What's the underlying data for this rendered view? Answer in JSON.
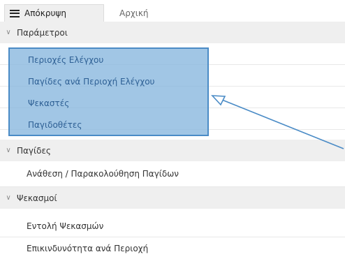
{
  "tabs": [
    {
      "label": "Απόκρυψη",
      "icon": "hamburger-icon",
      "active": true
    },
    {
      "label": "Αρχική",
      "active": false
    }
  ],
  "sections": [
    {
      "label": "Παράμετροι",
      "icon": "chevron-down-icon",
      "items": [
        "Περιοχές Ελέγχου",
        "Παγίδες ανά Περιοχή Ελέγχου",
        "Ψεκαστές",
        "Παγιδοθέτες"
      ]
    },
    {
      "label": "Παγίδες",
      "icon": "chevron-down-icon",
      "items": [
        "Ανάθεση / Παρακολούθηση Παγίδων"
      ]
    },
    {
      "label": "Ψεκασμοί",
      "icon": "chevron-down-icon",
      "items": [
        "Εντολή Ψεκασμών",
        "Επικινδυνότητα ανά Περιοχή"
      ]
    }
  ],
  "colors": {
    "highlight_fill": "#87b6de",
    "highlight_border": "#4a8bc6",
    "section_bg": "#efefef",
    "arrow": "#4a8bc6"
  }
}
